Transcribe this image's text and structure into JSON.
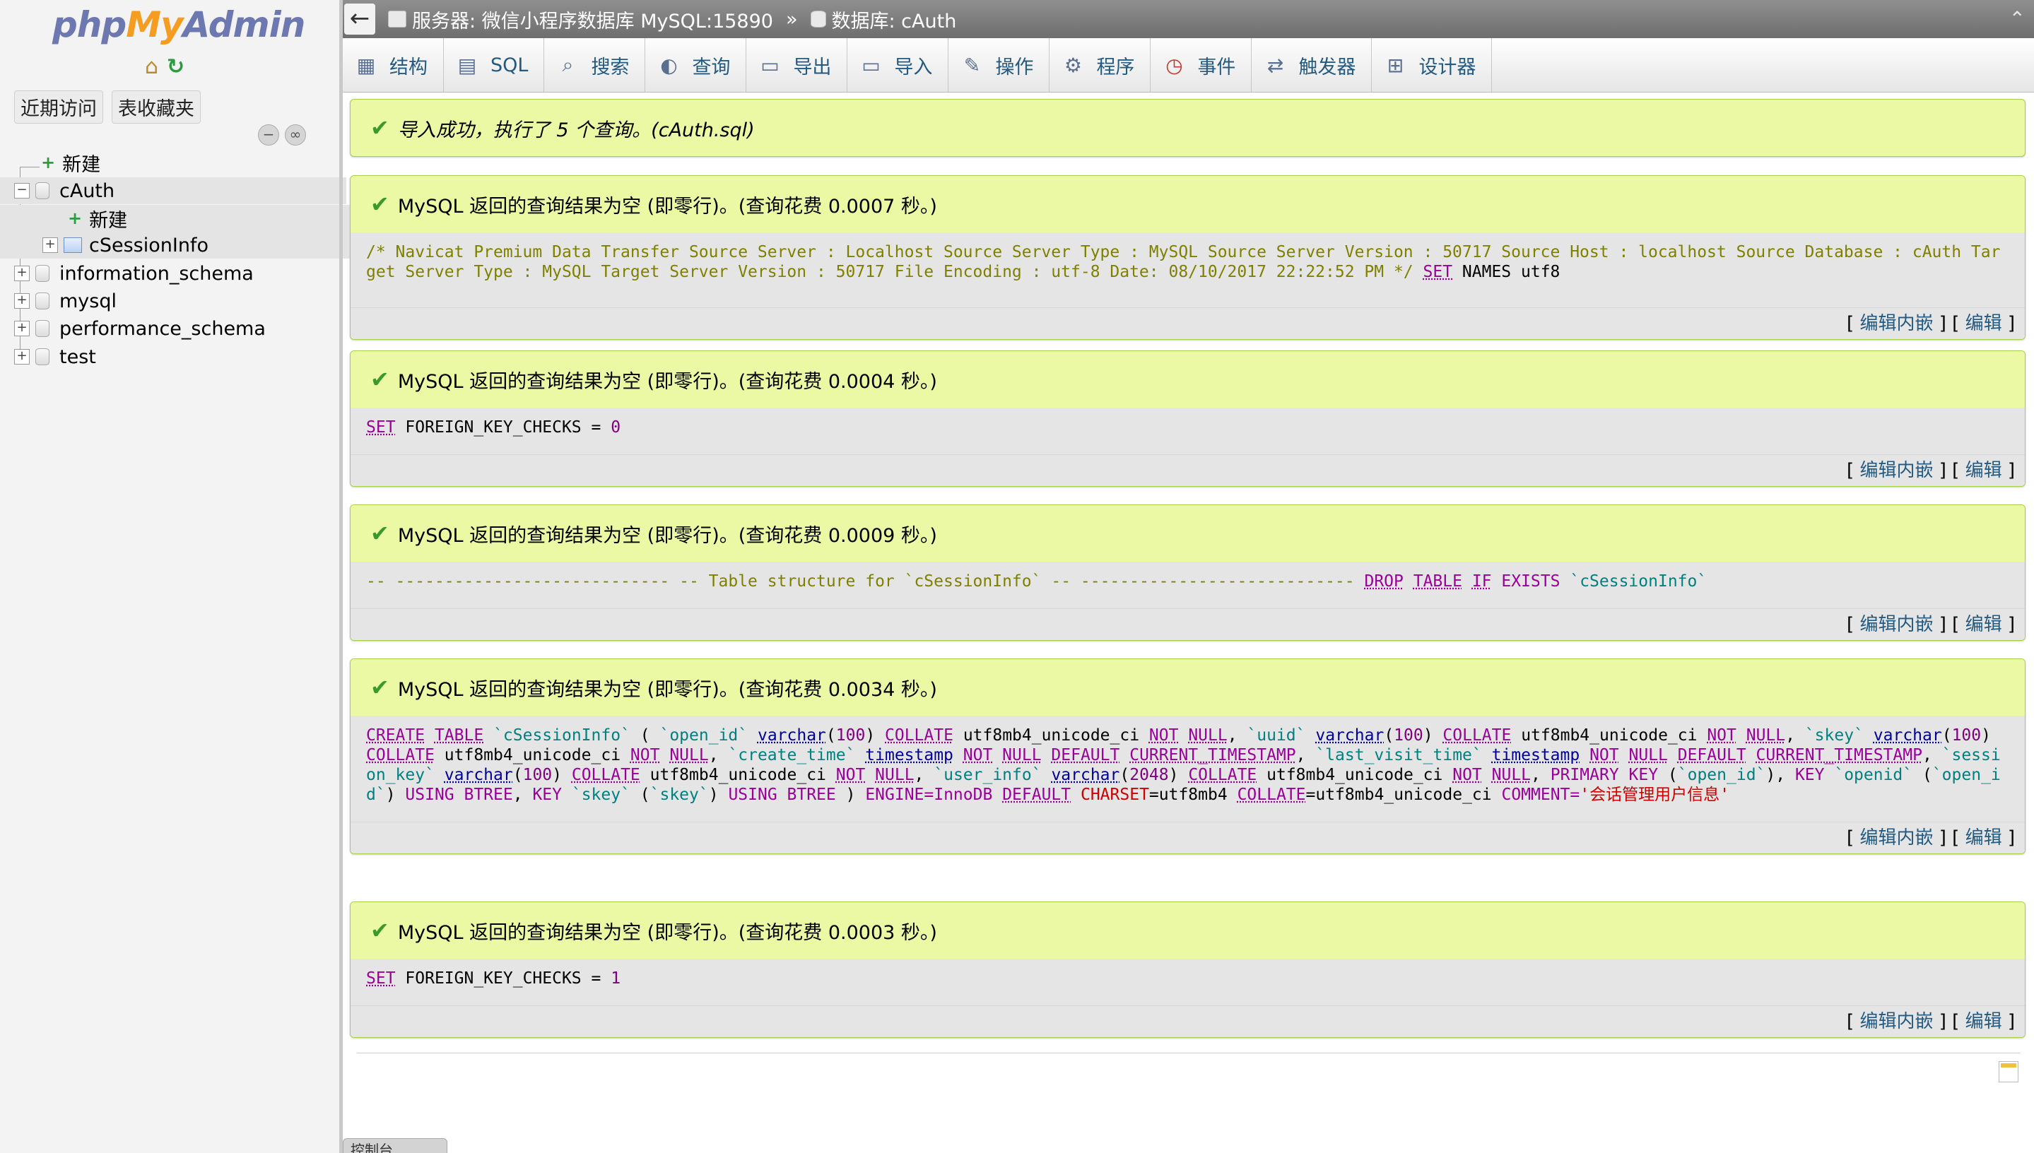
{
  "sidebar": {
    "logo": {
      "php": "php",
      "my": "My",
      "admin": "Admin"
    },
    "icons": [
      "home-icon",
      "reload-icon"
    ],
    "tabs": [
      "近期访问",
      "表收藏夹"
    ],
    "tree": [
      {
        "label": "新建",
        "kind": "new"
      },
      {
        "label": "cAuth",
        "kind": "db",
        "expanded": true
      },
      {
        "label": "新建",
        "kind": "new-child"
      },
      {
        "label": "cSessionInfo",
        "kind": "table"
      },
      {
        "label": "information_schema",
        "kind": "db"
      },
      {
        "label": "mysql",
        "kind": "db"
      },
      {
        "label": "performance_schema",
        "kind": "db"
      },
      {
        "label": "test",
        "kind": "db"
      }
    ]
  },
  "topbar": {
    "back_label": "←",
    "server": "服务器: 微信小程序数据库 MySQL:15890",
    "sep": "»",
    "database": "数据库: cAuth"
  },
  "tabs": [
    {
      "label": "结构",
      "icon": "structure-icon"
    },
    {
      "label": "SQL",
      "icon": "sql-icon"
    },
    {
      "label": "搜索",
      "icon": "search-icon"
    },
    {
      "label": "查询",
      "icon": "query-icon"
    },
    {
      "label": "导出",
      "icon": "export-icon"
    },
    {
      "label": "导入",
      "icon": "import-icon"
    },
    {
      "label": "操作",
      "icon": "wrench-icon"
    },
    {
      "label": "程序",
      "icon": "gears-icon"
    },
    {
      "label": "事件",
      "icon": "clock-icon"
    },
    {
      "label": "触发器",
      "icon": "trigger-icon"
    },
    {
      "label": "设计器",
      "icon": "designer-icon"
    }
  ],
  "import_message": "导入成功，执行了 5 个查询。(cAuth.sql)",
  "results": [
    {
      "message": "MySQL 返回的查询结果为空 (即零行)。(查询花费 0.0007 秒。)",
      "sql_comment": "/* Navicat Premium Data Transfer Source Server : Localhost Source Server Type : MySQL Source Server Version : 50717 Source Host : localhost Source Database : cAuth Target Server Type : MySQL Target Server Version : 50717 File Encoding : utf-8 Date: 08/10/2017 22:22:52 PM */",
      "sql_set": "SET",
      "sql_rest": "NAMES utf8"
    },
    {
      "message": "MySQL 返回的查询结果为空 (即零行)。(查询花费 0.0004 秒。)",
      "sql_set": "SET",
      "sql_rest": "FOREIGN_KEY_CHECKS = ",
      "sql_num": "0"
    },
    {
      "message": "MySQL 返回的查询结果为空 (即零行)。(查询花费 0.0009 秒。)",
      "comment1": "-- ----------------------------",
      "comment2": "-- Table structure for `cSessionInfo`",
      "comment3": "-- ----------------------------",
      "drop": "DROP",
      "table": "TABLE",
      "if": "IF",
      "exists": "EXISTS",
      "ident": "`cSessionInfo`"
    },
    {
      "message": "MySQL 返回的查询结果为空 (即零行)。(查询花费 0.0034 秒。)",
      "create_sql": {
        "create": "CREATE",
        "table": "TABLE",
        "tname": "`cSessionInfo`",
        "open_id": "`open_id`",
        "varchar": "varchar",
        "collate": "COLLATE",
        "collation": "utf8mb4_unicode_ci",
        "not": "NOT",
        "null": "NULL",
        "uuid": "`uuid`",
        "skey": "`skey`",
        "create_time": "`create_time`",
        "timestamp": "timestamp",
        "default": "DEFAULT",
        "current_ts": "CURRENT_TIMESTAMP",
        "last_visit_time": "`last_visit_time`",
        "session_key": "`session_key`",
        "user_info": "`user_info`",
        "primary_key": "PRIMARY KEY",
        "key": "KEY",
        "openid": "`openid`",
        "using_btree": "USING BTREE",
        "engine": "ENGINE=InnoDB",
        "charset": "CHARSET",
        "comment": "COMMENT=",
        "comment_text": "'会话管理用户信息'",
        "n100": "100",
        "n2048": "2048",
        "utf8mb4": "=utf8mb4"
      }
    },
    {
      "message": "MySQL 返回的查询结果为空 (即零行)。(查询花费 0.0003 秒。)",
      "sql_set": "SET",
      "sql_rest": "FOREIGN_KEY_CHECKS = ",
      "sql_num": "1"
    }
  ],
  "links": {
    "open": "[",
    "inline": "编辑内嵌",
    "mid": "] [",
    "edit": "编辑",
    "close": "]"
  },
  "console_label": "控制台",
  "colors": {
    "success_bg": "#ebf8a4",
    "success_border": "#a2d246",
    "link": "#235a81"
  }
}
